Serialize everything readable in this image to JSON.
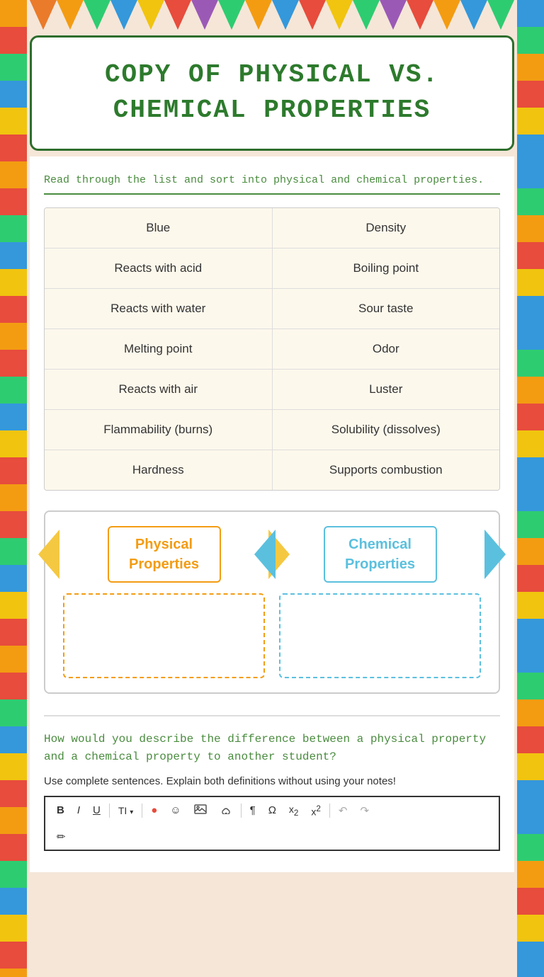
{
  "header": {
    "title_line1": "COPY OF PHYSICAL VS.",
    "title_line2": "CHEMICAL PROPERTIES"
  },
  "instruction": "Read through the list and sort into physical and chemical properties.",
  "sort_items": [
    {
      "left": "Blue",
      "right": "Density"
    },
    {
      "left": "Reacts with acid",
      "right": "Boiling point"
    },
    {
      "left": "Reacts with water",
      "right": "Sour taste"
    },
    {
      "left": "Melting point",
      "right": "Odor"
    },
    {
      "left": "Reacts with air",
      "right": "Luster"
    },
    {
      "left": "Flammability (burns)",
      "right": "Solubility (dissolves)"
    },
    {
      "left": "Hardness",
      "right": "Supports combustion"
    }
  ],
  "physical_properties_label": "Physical\nProperties",
  "chemical_properties_label": "Chemical\nProperties",
  "question": "How would you describe the difference between a physical property and a chemical property to another student?",
  "subtext": "Use complete sentences. Explain both definitions without using your notes!",
  "toolbar": {
    "bold": "B",
    "italic": "I",
    "underline": "U",
    "font_size": "TI▾",
    "color_icon": "●",
    "emoji_icon": "☺",
    "image_icon": "🖼",
    "link_icon": "🔗",
    "paragraph_icon": "¶",
    "omega_icon": "Ω",
    "subscript_icon": "x₂",
    "superscript_icon": "x²",
    "undo_icon": "↶",
    "redo_icon": "↷",
    "eraser_icon": "✏"
  },
  "colors": {
    "title_green": "#2d7a2d",
    "border_green": "#2d6e2d",
    "accent_orange": "#f39c12",
    "accent_blue": "#5bc0de",
    "cell_bg": "#fdf8ec",
    "body_bg": "#f5e6d8",
    "left_border": "#f39c12",
    "right_border": "#3498db"
  }
}
